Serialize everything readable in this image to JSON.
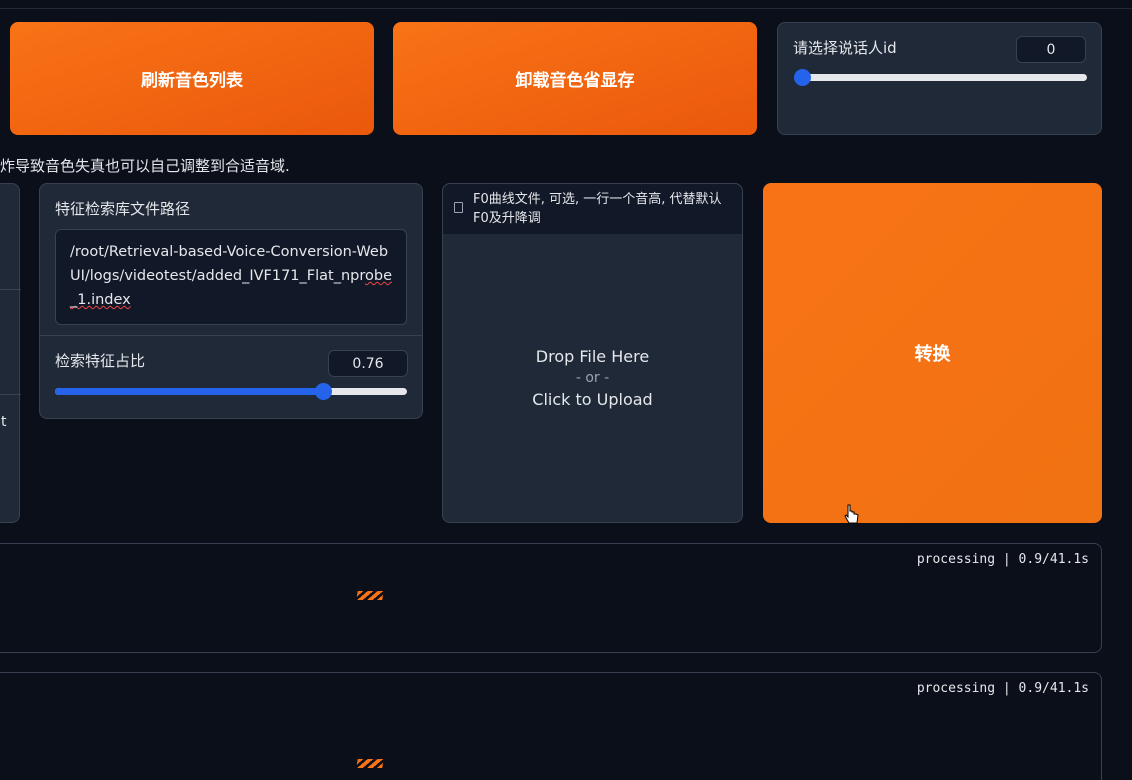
{
  "buttons": {
    "refresh_voices": "刷新音色列表",
    "unload_voice": "卸载音色省显存",
    "convert": "转换"
  },
  "speaker": {
    "label": "请选择说话人id",
    "value": "0",
    "slider_fraction": 0.0
  },
  "hint_text": "炸导致音色失真也可以自己调整到合适音域.",
  "index_path": {
    "label": "特征检索库文件路径",
    "value_parts": [
      "/root/Retrieval-based-Voice-Conversion-WebUI/logs/videotest/added_IVF171_Flat_npr",
      "obe_1.index"
    ]
  },
  "index_rate": {
    "label": "检索特征占比",
    "value": "0.76",
    "slider_fraction": 0.76
  },
  "f0_file": {
    "label": "F0曲线文件, 可选, 一行一个音高, 代替默认F0及升降调",
    "drop_text": "Drop File Here",
    "or_text": "- or -",
    "upload_text": "Click to Upload"
  },
  "left_edge_char": "t",
  "outputs": [
    {
      "status": "processing | 0.9/41.1s"
    },
    {
      "status": "processing | 0.9/41.1s"
    }
  ],
  "colors": {
    "accent": "#f97316",
    "slider": "#2563eb",
    "panel": "#1f2937",
    "background": "#0b0f19"
  }
}
